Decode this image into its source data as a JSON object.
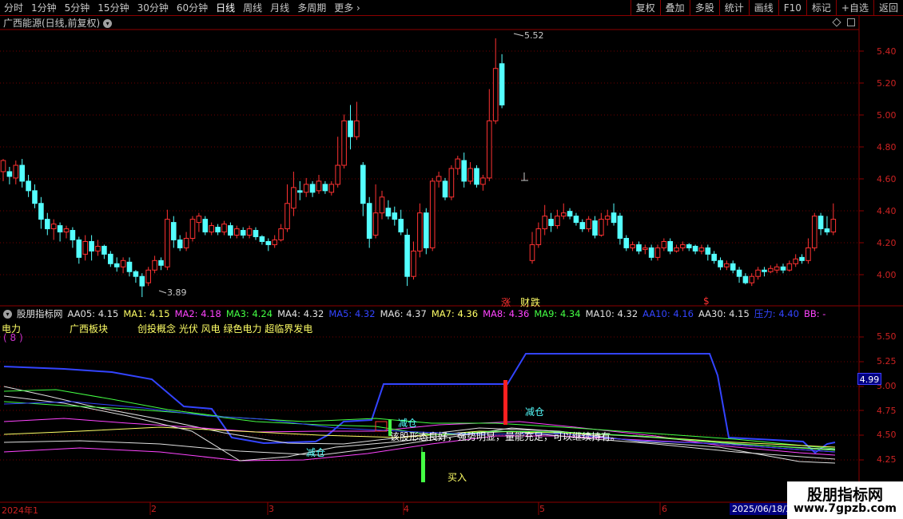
{
  "toolbar": {
    "left_items": [
      "分时",
      "1分钟",
      "5分钟",
      "15分钟",
      "30分钟",
      "60分钟",
      "日线",
      "周线",
      "月线",
      "多周期",
      "更多"
    ],
    "active": "日线",
    "right_items": [
      "复权",
      "叠加",
      "多股",
      "统计",
      "画线",
      "F10",
      "标记",
      "+自选",
      "返回"
    ]
  },
  "main": {
    "title": "广西能源(日线,前复权)",
    "y_ticks": [
      "5.40",
      "5.20",
      "5.00",
      "4.80",
      "4.60",
      "4.40",
      "4.20",
      "4.00"
    ],
    "high_label": "5.52",
    "low_label": "3.89",
    "tag_zhang": "涨",
    "tag_caibao": "财",
    "tag_die": "跌",
    "tag_dollar": "$"
  },
  "sub": {
    "name": "股朋指标网",
    "params": [
      {
        "text": "AA05: 4.15",
        "color": "#e0e0e0"
      },
      {
        "text": "MA1: 4.15",
        "color": "#ffff66"
      },
      {
        "text": "MA2: 4.18",
        "color": "#ff44ff"
      },
      {
        "text": "MA3: 4.24",
        "color": "#44ff44"
      },
      {
        "text": "MA4: 4.32",
        "color": "#e0e0e0"
      },
      {
        "text": "MA5: 4.32",
        "color": "#3344ff"
      },
      {
        "text": "MA6: 4.37",
        "color": "#e0e0e0"
      },
      {
        "text": "MA7: 4.36",
        "color": "#ffff66"
      },
      {
        "text": "MA8: 4.36",
        "color": "#ff44ff"
      },
      {
        "text": "MA9: 4.34",
        "color": "#44ff44"
      },
      {
        "text": "MA10: 4.32",
        "color": "#e0e0e0"
      },
      {
        "text": "AA10: 4.16",
        "color": "#3344ff"
      },
      {
        "text": "AA30: 4.15",
        "color": "#e0e0e0"
      },
      {
        "text": "压力: 4.40",
        "color": "#3344ff"
      },
      {
        "text": "BB: -",
        "color": "#ff44ff"
      }
    ],
    "industry": "电力",
    "sector": "广西板块",
    "concepts": "创投概念 光伏 风电 绿色电力 超临界发电",
    "count": "( 8 )",
    "y_ticks": [
      "5.50",
      "5.25",
      "5.00",
      "4.75",
      "4.50",
      "4.25"
    ],
    "current_value": "4.99",
    "signal_reduce": "减仓",
    "signal_buy": "买入",
    "signal_label_1": "减仓",
    "comment": "该股形态良好，强势明显，量能充足，可以继续持有。"
  },
  "date_axis": {
    "labels": [
      "2024年1",
      "2",
      "3",
      "4",
      "5",
      "6"
    ],
    "current_date": "2025/06/18/3"
  },
  "watermark": {
    "line1": "股朋指标网",
    "line2": "www.7gpzb.com"
  },
  "colors": {
    "up": "#ff3232",
    "down": "#54ffff",
    "grid": "#8b0000"
  },
  "chart_data": {
    "type": "candlestick",
    "y_range": [
      3.85,
      5.55
    ],
    "candles": [
      [
        4.68,
        4.75,
        4.62,
        4.76
      ],
      [
        4.68,
        4.65,
        4.6,
        4.71
      ],
      [
        4.64,
        4.72,
        4.6,
        4.75
      ],
      [
        4.72,
        4.62,
        4.58,
        4.76
      ],
      [
        4.62,
        4.56,
        4.52,
        4.66
      ],
      [
        4.56,
        4.48,
        4.45,
        4.6
      ],
      [
        4.48,
        4.38,
        4.32,
        4.52
      ],
      [
        4.38,
        4.32,
        4.28,
        4.42
      ],
      [
        4.32,
        4.35,
        4.25,
        4.38
      ],
      [
        4.34,
        4.3,
        4.24,
        4.36
      ],
      [
        4.3,
        4.32,
        4.26,
        4.34
      ],
      [
        4.31,
        4.25,
        4.2,
        4.33
      ],
      [
        4.25,
        4.14,
        4.1,
        4.27
      ],
      [
        4.16,
        4.24,
        4.12,
        4.28
      ],
      [
        4.24,
        4.18,
        4.12,
        4.28
      ],
      [
        4.18,
        4.21,
        4.15,
        4.25
      ],
      [
        4.21,
        4.16,
        4.13,
        4.22
      ],
      [
        4.16,
        4.1,
        4.08,
        4.18
      ],
      [
        4.1,
        4.08,
        4.05,
        4.14
      ],
      [
        4.08,
        4.12,
        4.04,
        4.14
      ],
      [
        4.11,
        4.05,
        4.02,
        4.14
      ],
      [
        4.05,
        4.02,
        3.98,
        4.06
      ],
      [
        4.02,
        3.96,
        3.89,
        4.04
      ],
      [
        3.98,
        4.06,
        3.96,
        4.08
      ],
      [
        4.06,
        4.12,
        4.04,
        4.15
      ],
      [
        4.12,
        4.09,
        4.06,
        4.14
      ],
      [
        4.08,
        4.38,
        4.06,
        4.44
      ],
      [
        4.36,
        4.25,
        4.2,
        4.4
      ],
      [
        4.25,
        4.2,
        4.18,
        4.28
      ],
      [
        4.2,
        4.26,
        4.18,
        4.3
      ],
      [
        4.26,
        4.38,
        4.24,
        4.4
      ],
      [
        4.36,
        4.4,
        4.3,
        4.42
      ],
      [
        4.38,
        4.3,
        4.28,
        4.4
      ],
      [
        4.3,
        4.34,
        4.28,
        4.36
      ],
      [
        4.33,
        4.3,
        4.28,
        4.35
      ],
      [
        4.3,
        4.35,
        4.28,
        4.37
      ],
      [
        4.34,
        4.28,
        4.26,
        4.36
      ],
      [
        4.28,
        4.32,
        4.26,
        4.34
      ],
      [
        4.31,
        4.28,
        4.26,
        4.33
      ],
      [
        4.28,
        4.32,
        4.26,
        4.34
      ],
      [
        4.31,
        4.27,
        4.25,
        4.33
      ],
      [
        4.27,
        4.24,
        4.22,
        4.28
      ],
      [
        4.24,
        4.22,
        4.18,
        4.26
      ],
      [
        4.22,
        4.25,
        4.2,
        4.28
      ],
      [
        4.25,
        4.32,
        4.24,
        4.35
      ],
      [
        4.32,
        4.48,
        4.3,
        4.6
      ],
      [
        4.45,
        4.58,
        4.4,
        4.68
      ],
      [
        4.56,
        4.55,
        4.5,
        4.62
      ],
      [
        4.55,
        4.6,
        4.52,
        4.64
      ],
      [
        4.6,
        4.55,
        4.52,
        4.62
      ],
      [
        4.56,
        4.62,
        4.54,
        4.66
      ],
      [
        4.6,
        4.56,
        4.54,
        4.62
      ],
      [
        4.55,
        4.6,
        4.53,
        4.62
      ],
      [
        4.6,
        4.72,
        4.58,
        4.9
      ],
      [
        4.72,
        5.0,
        4.7,
        5.04
      ],
      [
        5.0,
        4.9,
        4.82,
        5.1
      ],
      [
        4.9,
        5.0,
        4.88,
        5.12
      ],
      [
        4.72,
        4.48,
        4.4,
        4.74
      ],
      [
        4.48,
        4.26,
        4.2,
        4.52
      ],
      [
        4.28,
        4.42,
        4.26,
        4.6
      ],
      [
        4.42,
        4.52,
        4.38,
        4.56
      ],
      [
        4.45,
        4.4,
        4.38,
        4.5
      ],
      [
        4.42,
        4.38,
        4.34,
        4.46
      ],
      [
        4.38,
        4.3,
        4.28,
        4.44
      ],
      [
        4.28,
        4.02,
        3.96,
        4.32
      ],
      [
        4.02,
        4.18,
        4.0,
        4.24
      ],
      [
        4.18,
        4.42,
        4.14,
        4.48
      ],
      [
        4.42,
        4.2,
        4.16,
        4.45
      ],
      [
        4.2,
        4.62,
        4.18,
        4.64
      ],
      [
        4.62,
        4.65,
        4.58,
        4.68
      ],
      [
        4.62,
        4.52,
        4.5,
        4.64
      ],
      [
        4.52,
        4.7,
        4.5,
        4.72
      ],
      [
        4.7,
        4.76,
        4.66,
        4.78
      ],
      [
        4.75,
        4.62,
        4.58,
        4.8
      ],
      [
        4.62,
        4.7,
        4.6,
        4.74
      ],
      [
        4.7,
        4.6,
        4.58,
        4.72
      ],
      [
        4.6,
        4.64,
        4.56,
        4.66
      ],
      [
        4.64,
        5.0,
        4.62,
        5.2
      ],
      [
        5.0,
        5.33,
        4.98,
        5.52
      ],
      [
        5.36,
        5.1,
        5.08,
        5.42
      ]
    ],
    "candles_after_gap": [
      [
        4.12,
        4.22,
        4.1,
        4.3
      ],
      [
        4.22,
        4.32,
        4.2,
        4.36
      ],
      [
        4.32,
        4.4,
        4.28,
        4.47
      ],
      [
        4.38,
        4.34,
        4.3,
        4.42
      ],
      [
        4.34,
        4.4,
        4.32,
        4.44
      ],
      [
        4.4,
        4.42,
        4.38,
        4.48
      ],
      [
        4.43,
        4.4,
        4.38,
        4.45
      ],
      [
        4.4,
        4.36,
        4.34,
        4.42
      ],
      [
        4.36,
        4.32,
        4.3,
        4.38
      ],
      [
        4.32,
        4.38,
        4.3,
        4.4
      ],
      [
        4.37,
        4.28,
        4.26,
        4.4
      ],
      [
        4.28,
        4.38,
        4.27,
        4.42
      ],
      [
        4.38,
        4.4,
        4.34,
        4.44
      ],
      [
        4.42,
        4.36,
        4.34,
        4.48
      ],
      [
        4.4,
        4.26,
        4.22,
        4.42
      ],
      [
        4.26,
        4.2,
        4.18,
        4.28
      ],
      [
        4.2,
        4.22,
        4.18,
        4.24
      ],
      [
        4.22,
        4.18,
        4.16,
        4.24
      ],
      [
        4.19,
        4.2,
        4.16,
        4.22
      ],
      [
        4.2,
        4.14,
        4.12,
        4.22
      ],
      [
        4.14,
        4.2,
        4.12,
        4.22
      ],
      [
        4.2,
        4.24,
        4.18,
        4.26
      ],
      [
        4.24,
        4.18,
        4.16,
        4.26
      ],
      [
        4.18,
        4.2,
        4.17,
        4.22
      ],
      [
        4.2,
        4.22,
        4.18,
        4.24
      ],
      [
        4.22,
        4.2,
        4.18,
        4.23
      ],
      [
        4.21,
        4.18,
        4.16,
        4.22
      ],
      [
        4.18,
        4.2,
        4.16,
        4.22
      ],
      [
        4.2,
        4.16,
        4.12,
        4.22
      ],
      [
        4.16,
        4.12,
        4.1,
        4.18
      ],
      [
        4.12,
        4.08,
        4.06,
        4.14
      ],
      [
        4.08,
        4.1,
        4.06,
        4.12
      ],
      [
        4.1,
        4.06,
        4.04,
        4.12
      ],
      [
        4.06,
        4.02,
        3.98,
        4.08
      ],
      [
        4.02,
        3.98,
        3.97,
        4.04
      ],
      [
        3.98,
        4.02,
        3.96,
        4.04
      ],
      [
        4.02,
        4.06,
        4.0,
        4.08
      ],
      [
        4.06,
        4.05,
        4.02,
        4.08
      ],
      [
        4.05,
        4.07,
        4.04,
        4.09
      ],
      [
        4.06,
        4.08,
        4.04,
        4.1
      ],
      [
        4.08,
        4.06,
        4.04,
        4.1
      ],
      [
        4.06,
        4.1,
        4.05,
        4.12
      ],
      [
        4.1,
        4.13,
        4.08,
        4.16
      ],
      [
        4.14,
        4.12,
        4.1,
        4.16
      ],
      [
        4.12,
        4.2,
        4.1,
        4.26
      ],
      [
        4.2,
        4.4,
        4.18,
        4.42
      ],
      [
        4.4,
        4.32,
        4.28,
        4.42
      ],
      [
        4.32,
        4.3,
        4.28,
        4.4
      ],
      [
        4.3,
        4.38,
        4.28,
        4.48
      ]
    ]
  }
}
